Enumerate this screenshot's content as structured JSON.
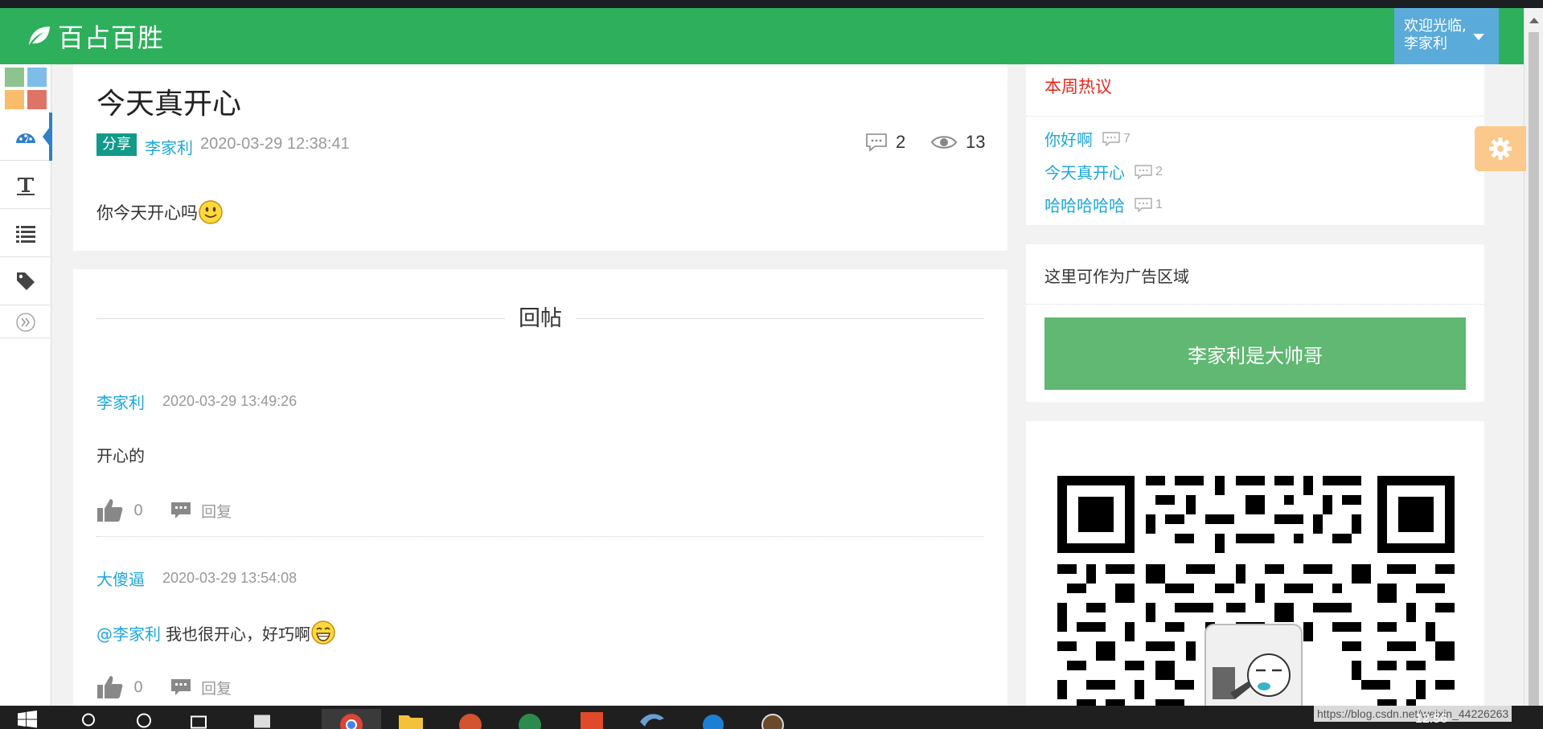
{
  "header": {
    "logo_text": "百占百胜",
    "user_greeting": "欢迎光临,",
    "user_name": "李家利"
  },
  "colors": {
    "header_green": "#2eaf5c",
    "link_blue": "#1da7d8",
    "tag_teal": "#119a8a",
    "hot_red": "#e52a1f",
    "ad_green": "#60b872",
    "user_menu_blue": "#5aabd9"
  },
  "sidebar": {
    "icons": [
      "palette-swatches-icon",
      "dashboard-icon",
      "text-icon",
      "list-icon",
      "tag-icon",
      "expand-icon"
    ]
  },
  "post": {
    "title": "今天真开心",
    "tag": "分享",
    "author": "李家利",
    "date": "2020-03-29 12:38:41",
    "comment_count": "2",
    "view_count": "13",
    "body": "你今天开心吗"
  },
  "replies_section": {
    "title": "回帖",
    "items": [
      {
        "name": "李家利",
        "time": "2020-03-29 13:49:26",
        "content": "开心的",
        "likes": "0",
        "reply_label": "回复"
      },
      {
        "name": "大傻逼",
        "time": "2020-03-29 13:54:08",
        "mention": "@李家利",
        "content": "我也很开心，好巧啊",
        "likes": "0",
        "reply_label": "回复"
      }
    ]
  },
  "hot_topics": {
    "title": "本周热议",
    "items": [
      {
        "title": "你好啊",
        "count": "7"
      },
      {
        "title": "今天真开心",
        "count": "2"
      },
      {
        "title": "哈哈哈哈哈",
        "count": "1"
      }
    ]
  },
  "ad": {
    "title": "这里可作为广告区域",
    "banner": "李家利是大帅哥"
  },
  "taskbar": {
    "url": "https://blog.csdn.net/weixin_44226263",
    "clock": "12:56"
  }
}
